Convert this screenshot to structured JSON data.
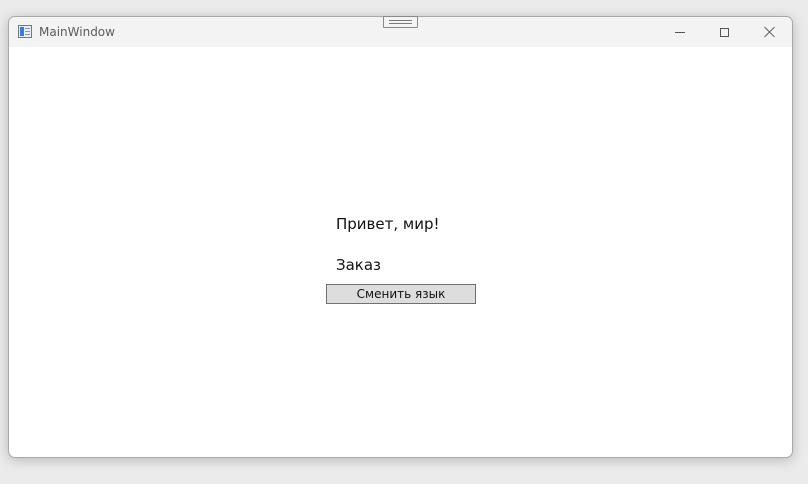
{
  "window": {
    "title": "MainWindow"
  },
  "icons": {
    "app": "app-window-icon",
    "minimize": "minimize-icon",
    "maximize": "maximize-icon",
    "close": "close-icon",
    "snap": "snap-layout-handle-icon"
  },
  "content": {
    "greeting": "Привет, мир!",
    "order_label": "Заказ",
    "change_language_button": "Сменить язык"
  },
  "colors": {
    "window_background": "#ffffff",
    "titlebar_background": "#f3f3f3",
    "button_background": "#dddddd",
    "button_border": "#707070"
  }
}
